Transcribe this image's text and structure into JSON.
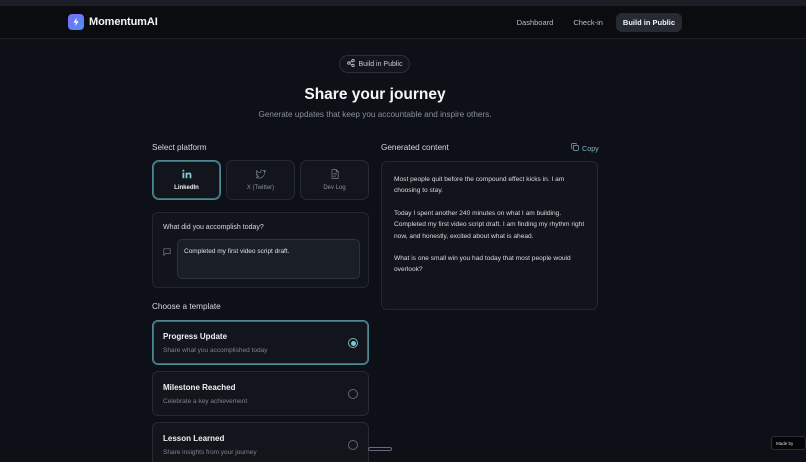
{
  "app": {
    "name": "MomentumAI"
  },
  "nav": {
    "items": [
      "Dashboard",
      "Check-in",
      "Build in Public"
    ],
    "active": 2
  },
  "hero": {
    "badge": "Build in Public",
    "title": "Share your journey",
    "subtitle": "Generate updates that keep you accountable and inspire others."
  },
  "platform": {
    "label": "Select platform",
    "options": [
      {
        "label": "LinkedIn",
        "icon": "linkedin-icon",
        "active": true
      },
      {
        "label": "X (Twitter)",
        "icon": "twitter-icon",
        "active": false
      },
      {
        "label": "Dev Log",
        "icon": "document-icon",
        "active": false
      }
    ]
  },
  "accomplish": {
    "label": "What did you accomplish today?",
    "value": "Completed my first video script draft."
  },
  "template": {
    "label": "Choose a template",
    "options": [
      {
        "title": "Progress Update",
        "desc": "Share what you accomplished today",
        "selected": true
      },
      {
        "title": "Milestone Reached",
        "desc": "Celebrate a key achievement",
        "selected": false
      },
      {
        "title": "Lesson Learned",
        "desc": "Share insights from your journey",
        "selected": false
      }
    ]
  },
  "generated": {
    "label": "Generated content",
    "copy_label": "Copy",
    "paragraphs": [
      "Most people quit before the compound effect kicks in. I am choosing to stay.",
      "Today I spent another 240 minutes on what I am building. Completed my first video script draft. I am finding my rhythm right now, and honestly, excited about what is ahead.",
      "What is one small win you had today that most people would overlook?"
    ]
  },
  "footer": {
    "made_by": "Made by"
  },
  "colors": {
    "accent": "#4c8b96",
    "brand_gradient_start": "#7c6cf5",
    "brand_gradient_end": "#4f8df6"
  }
}
